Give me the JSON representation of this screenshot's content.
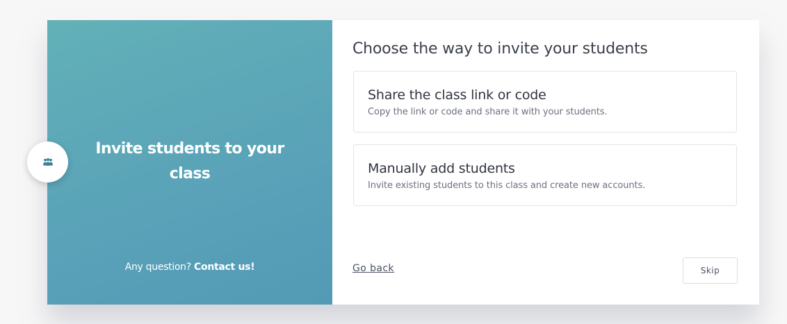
{
  "left_panel": {
    "title": "Invite students to your class",
    "footer_prefix": "Any question?",
    "footer_link": "Contact us!",
    "icon": "users-icon"
  },
  "right_panel": {
    "heading": "Choose the way to invite your students",
    "options": [
      {
        "title": "Share the class link or code",
        "description": "Copy the link or code and share it with your students."
      },
      {
        "title": "Manually add students",
        "description": "Invite existing students to this class and create new accounts."
      }
    ],
    "go_back_label": "Go back",
    "skip_label": "Skip"
  },
  "colors": {
    "panel_gradient_start": "#62b1b8",
    "panel_gradient_end": "#539ab6",
    "icon_color": "#3f7f98",
    "text_dark": "#30343f",
    "text_muted": "#6b7080"
  }
}
